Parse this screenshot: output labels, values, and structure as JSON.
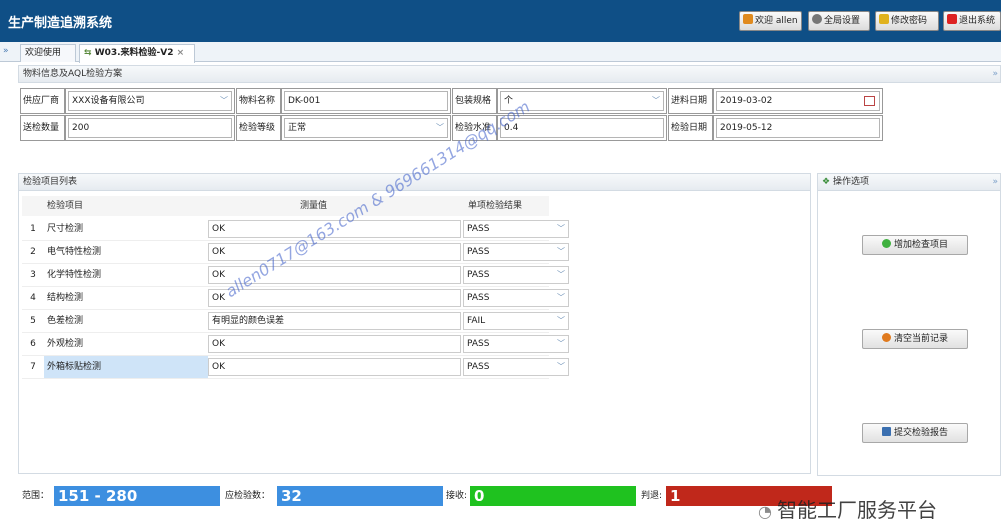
{
  "header": {
    "title": "生产制造追溯系统",
    "user_label": "欢迎 allen",
    "settings_label": "全局设置",
    "password_label": "修改密码",
    "logout_label": "退出系统"
  },
  "tabs": {
    "toggle": "»",
    "welcome": "欢迎使用",
    "active_tab": "W03.来料检验-V2",
    "active_close": "×"
  },
  "material_panel": {
    "title": "物料信息及AQL检验方案",
    "collapse": "»",
    "supplier_label": "供应厂商",
    "supplier_value": "XXX设备有限公司",
    "material_label": "物料名称",
    "material_value": "DK-001",
    "pack_label": "包装规格",
    "pack_value": "个",
    "arrival_label": "进料日期",
    "arrival_value": "2019-03-02",
    "qty_label": "送检数量",
    "qty_value": "200",
    "level_label": "检验等级",
    "level_value": "正常",
    "standard_label": "检验水准",
    "standard_value": "0.4",
    "inspect_date_label": "检验日期",
    "inspect_date_value": "2019-05-12"
  },
  "items_panel": {
    "title": "检验项目列表",
    "columns": [
      "检验项目",
      "测量值",
      "单项检验结果"
    ],
    "rows": [
      {
        "num": "1",
        "name": "尺寸检测",
        "value": "OK",
        "result": "PASS"
      },
      {
        "num": "2",
        "name": "电气特性检测",
        "value": "OK",
        "result": "PASS"
      },
      {
        "num": "3",
        "name": "化学特性检测",
        "value": "OK",
        "result": "PASS"
      },
      {
        "num": "4",
        "name": "结构检测",
        "value": "OK",
        "result": "PASS"
      },
      {
        "num": "5",
        "name": "色差检测",
        "value": "有明显的颜色误差",
        "result": "FAIL"
      },
      {
        "num": "6",
        "name": "外观检测",
        "value": "OK",
        "result": "PASS"
      },
      {
        "num": "7",
        "name": "外箱标贴检测",
        "value": "OK",
        "result": "PASS"
      }
    ]
  },
  "ops_panel": {
    "title": "操作选项",
    "collapse": "»",
    "add_label": "增加检查项目",
    "clear_label": "清空当前记录",
    "submit_label": "提交检验报告"
  },
  "status": {
    "range_label": "范围：",
    "range_value": "151 - 280",
    "count_label": "应检验数：",
    "count_value": "32",
    "accept_label": "接收:",
    "accept_value": "0",
    "reject_label": "判退:",
    "reject_value": "1"
  },
  "watermark": "allen0717@163.com & 969661314@qq.com",
  "brand": "智能工厂服务平台",
  "colors": {
    "header": "#0f4f86",
    "range": "#3d8fe0",
    "count": "#3d8fe0",
    "accept": "#1fc21f",
    "reject": "#c0281b"
  }
}
